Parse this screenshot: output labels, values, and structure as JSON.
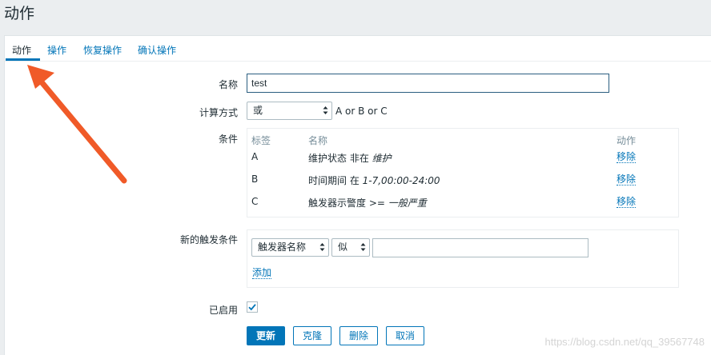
{
  "page": {
    "title": "动作"
  },
  "tabs": [
    {
      "label": "动作",
      "active": true
    },
    {
      "label": "操作",
      "active": false
    },
    {
      "label": "恢复操作",
      "active": false
    },
    {
      "label": "确认操作",
      "active": false
    }
  ],
  "form": {
    "name_label": "名称",
    "name_value": "test",
    "calc_label": "计算方式",
    "calc_selected": "或",
    "calc_formula": "A or B or C",
    "conditions_label": "条件",
    "conditions_headers": {
      "tag": "标签",
      "name": "名称",
      "action": "动作"
    },
    "conditions": [
      {
        "tag": "A",
        "prefix": "维护状态 非在 ",
        "value": "维护",
        "remove": "移除"
      },
      {
        "tag": "B",
        "prefix": "时间期间 在 ",
        "value": "1-7,00:00-24:00",
        "remove": "移除"
      },
      {
        "tag": "C",
        "prefix": "触发器示警度 >= ",
        "value": "一般严重",
        "remove": "移除"
      }
    ],
    "new_condition_label": "新的触发条件",
    "new_condition_type": "触发器名称",
    "new_condition_operator": "似",
    "new_condition_value": "",
    "add_link": "添加",
    "enabled_label": "已启用",
    "enabled": true
  },
  "buttons": {
    "update": "更新",
    "clone": "克隆",
    "delete": "删除",
    "cancel": "取消"
  },
  "watermark": "https://blog.csdn.net/qq_39567748",
  "colors": {
    "accent": "#0275b8",
    "annotation_arrow": "#f05a28"
  }
}
